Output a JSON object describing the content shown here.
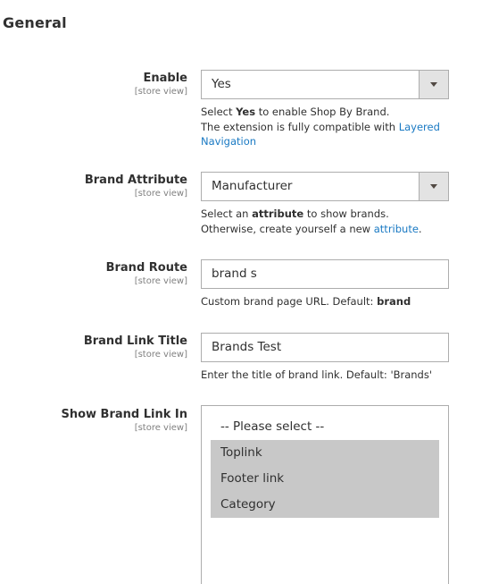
{
  "section": {
    "title": "General"
  },
  "fields": {
    "enable": {
      "label": "Enable",
      "scope": "[store view]",
      "value": "Yes",
      "note": {
        "pre": "Select ",
        "bold": "Yes",
        "post": " to enable Shop By Brand.",
        "line2": "The extension is fully compatible with ",
        "link": "Layered Navigation"
      }
    },
    "brand_attribute": {
      "label": "Brand Attribute",
      "scope": "[store view]",
      "value": "Manufacturer",
      "note": {
        "pre": "Select an ",
        "bold": "attribute",
        "post": " to show brands.",
        "line2": "Otherwise, create yourself a new ",
        "link": "attribute",
        "end": "."
      }
    },
    "brand_route": {
      "label": "Brand Route",
      "scope": "[store view]",
      "value": "brand s",
      "note": {
        "pre": "Custom brand page URL. Default: ",
        "bold": "brand"
      }
    },
    "brand_link_title": {
      "label": "Brand Link Title",
      "scope": "[store view]",
      "value": "Brands Test",
      "note": "Enter the title of brand link. Default: 'Brands'"
    },
    "show_brand_link_in": {
      "label": "Show Brand Link In",
      "scope": "[store view]",
      "options": [
        {
          "label": "-- Please select --",
          "selected": false
        },
        {
          "label": "Toplink",
          "selected": true
        },
        {
          "label": "Footer link",
          "selected": true
        },
        {
          "label": "Category",
          "selected": true
        }
      ]
    }
  }
}
